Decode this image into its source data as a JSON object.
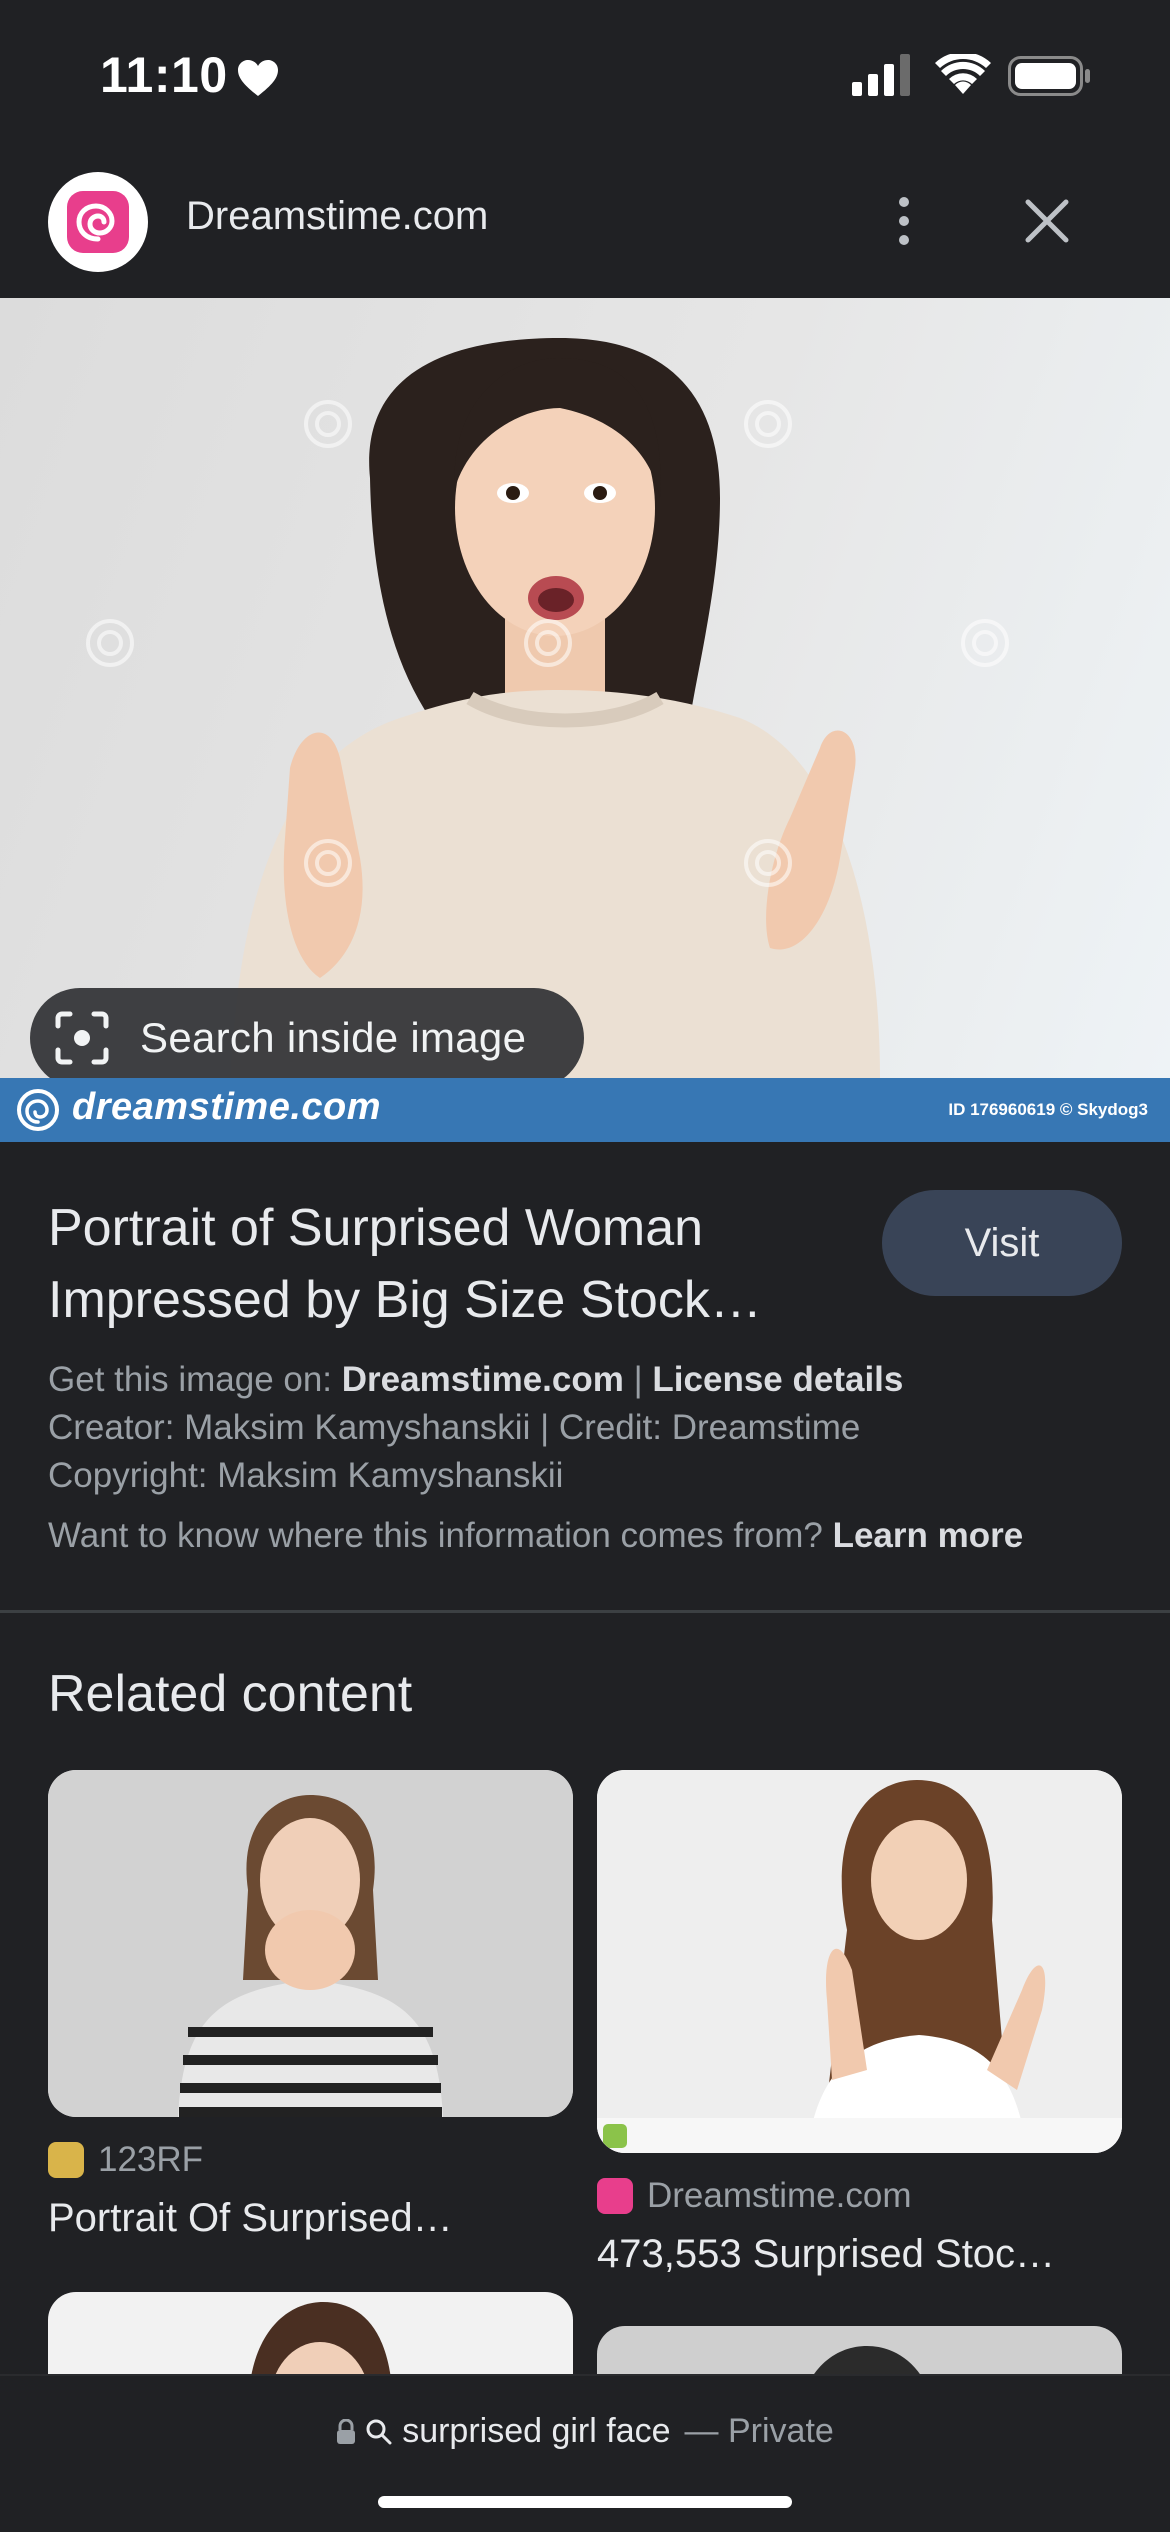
{
  "status_bar": {
    "time": "11:10"
  },
  "header": {
    "site_name": "Dreamstime.com"
  },
  "image": {
    "search_inside_label": "Search inside image",
    "watermark_brand": "dreamstime.com",
    "watermark_id": "ID 176960619 © Skydog3"
  },
  "info": {
    "title": "Portrait of Surprised Woman Impressed by Big Size Stock…",
    "visit_label": "Visit",
    "get_image_prefix": "Get this image on:",
    "get_image_site": "Dreamstime.com",
    "separator": "|",
    "license_link": "License details",
    "creator_line": "Creator: Maksim Kamyshanskii | Credit: Dreamstime",
    "copyright_line": "Copyright: Maksim Kamyshanskii",
    "want_to_know": "Want to know where this information comes from?",
    "learn_more": "Learn more"
  },
  "related": {
    "heading": "Related content",
    "items": [
      {
        "source": "123RF",
        "title": "Portrait Of Surprised…"
      },
      {
        "source": "Dreamstime.com",
        "title": "473,553 Surprised Stoc…"
      }
    ]
  },
  "bottom_bar": {
    "query": "surprised girl face",
    "private_label": "— Private"
  },
  "colors": {
    "background": "#202124",
    "visit_button": "#394457",
    "watermark_bar": "#3777b4",
    "dreamstime_pink": "#e83e8c"
  },
  "icons": [
    "heart-icon",
    "signal-icon",
    "wifi-icon",
    "battery-icon",
    "more-vert-icon",
    "close-icon",
    "lens-icon",
    "lock-icon",
    "search-icon"
  ]
}
